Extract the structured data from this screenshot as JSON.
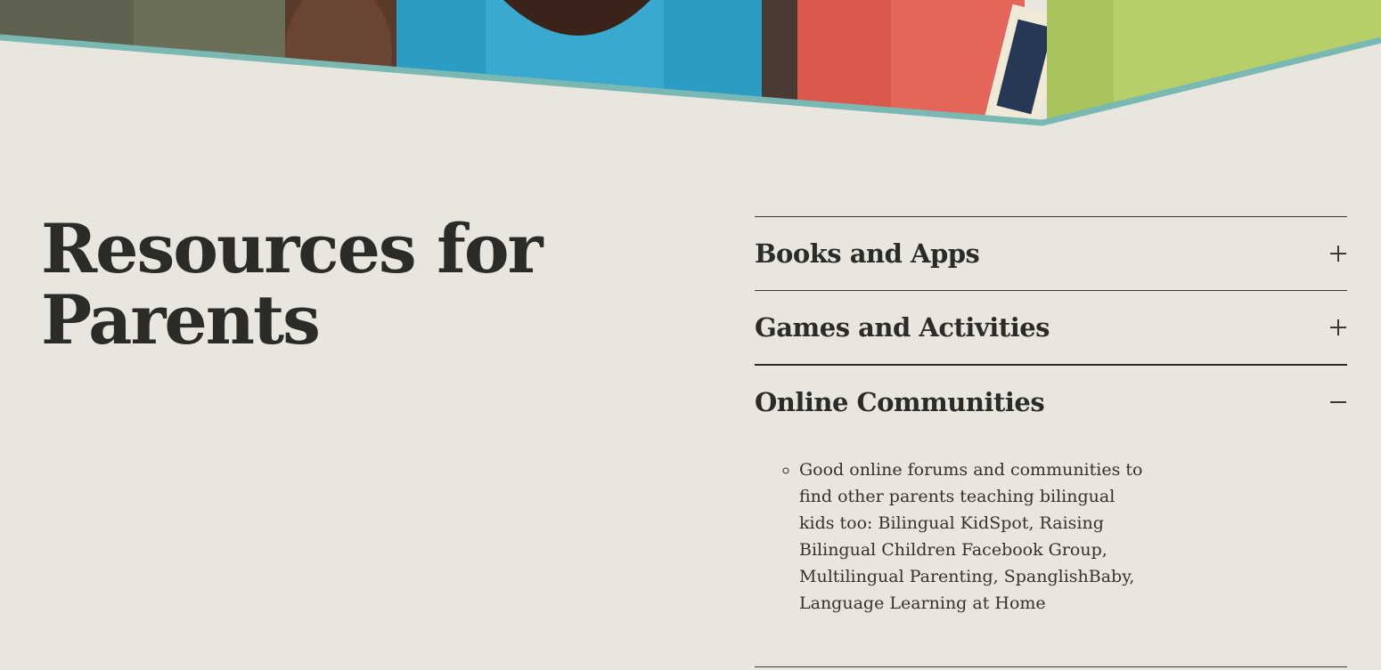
{
  "page": {
    "title": "Resources for Parents"
  },
  "accordion": {
    "items": [
      {
        "label": "Books and Apps",
        "state": "collapsed",
        "icon": "plus-icon"
      },
      {
        "label": "Games and Activities",
        "state": "collapsed",
        "icon": "plus-icon"
      },
      {
        "label": "Online Communities",
        "state": "expanded",
        "icon": "minus-icon",
        "content": [
          "Good online forums and communities to find other parents teaching bilingual kids too: Bilingual KidSpot, Raising Bilingual Children Facebook Group, Multilingual Parenting, SpanglishBaby, Language Learning at Home"
        ]
      }
    ]
  },
  "colors": {
    "background": "#e9e6df",
    "text": "#2b2b27",
    "accent_teal": "#7ab8b3"
  }
}
